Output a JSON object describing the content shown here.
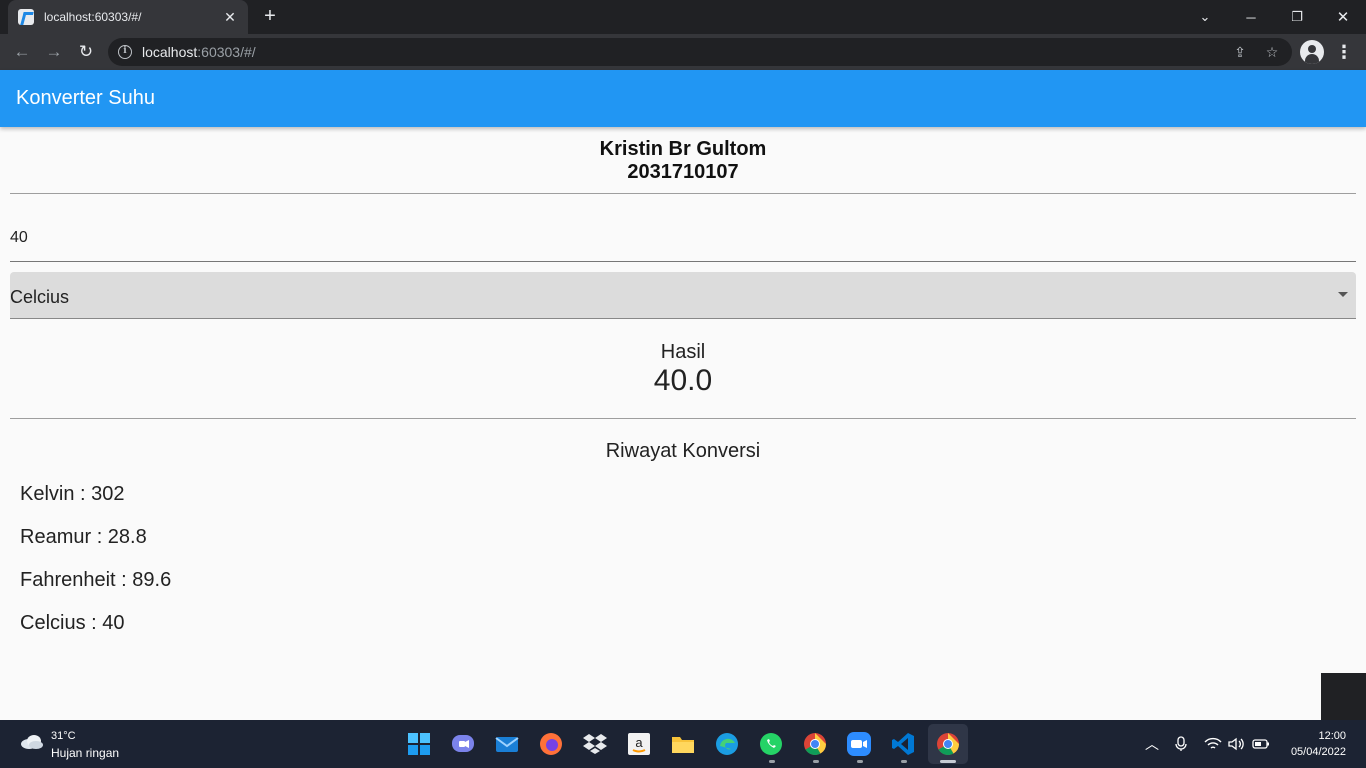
{
  "browser": {
    "tab_title": "localhost:60303/#/",
    "url_host": "localhost",
    "url_rest": ":60303/#/"
  },
  "app": {
    "title": "Konverter Suhu",
    "student_name": "Kristin Br Gultom",
    "student_id": "2031710107",
    "input_value": "40",
    "selected_unit": "Celcius",
    "result_label": "Hasil",
    "result_value": "40.0",
    "history_title": "Riwayat Konversi",
    "history": [
      "Kelvin : 302",
      "Reamur : 28.8",
      "Fahrenheit : 89.6",
      "Celcius : 40"
    ]
  },
  "taskbar": {
    "weather_temp": "31°C",
    "weather_desc": "Hujan ringan",
    "time": "12:00",
    "date": "05/04/2022"
  },
  "colors": {
    "appbar": "#2196f3",
    "taskbar": "#1c2333",
    "browser_frame": "#202124"
  }
}
